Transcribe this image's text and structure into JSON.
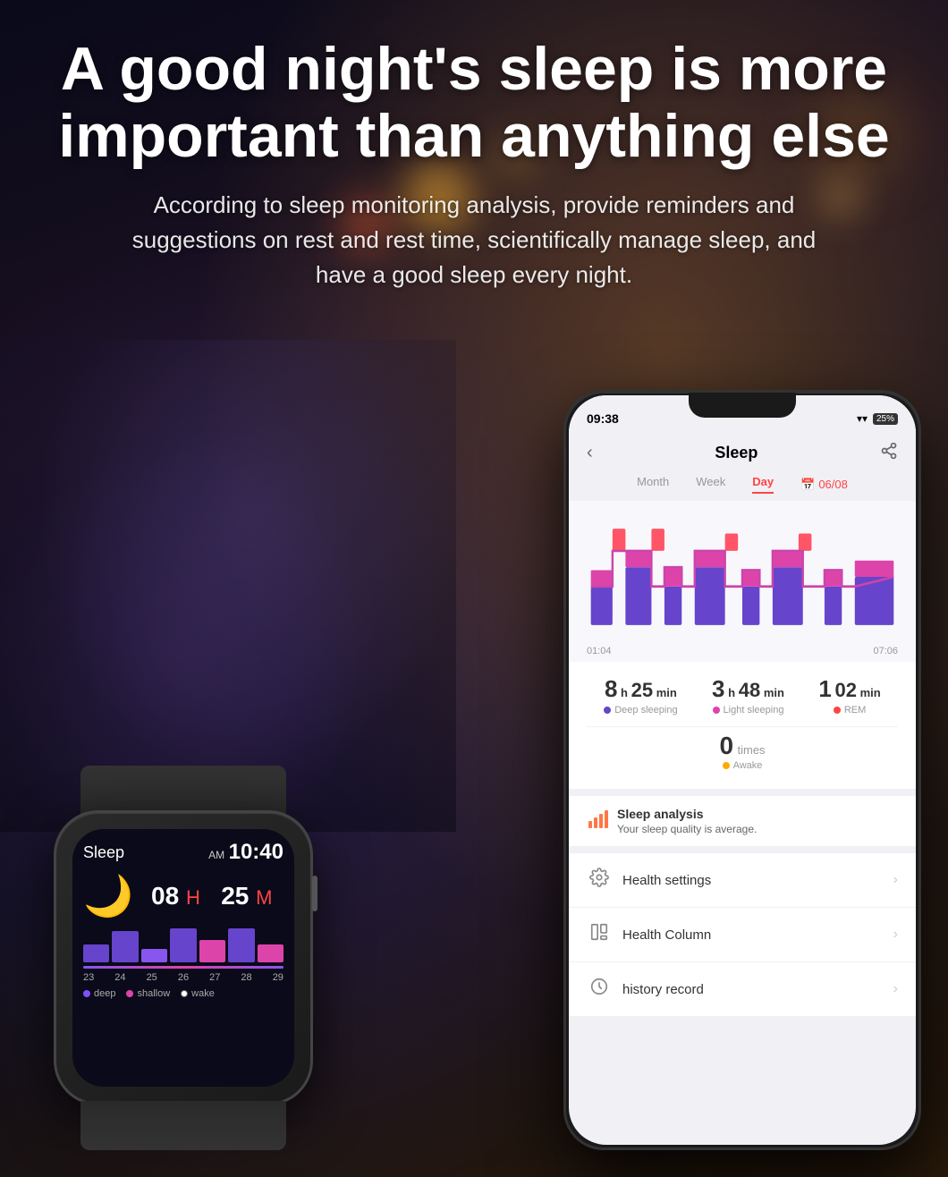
{
  "header": {
    "main_title": "A good night's sleep is more important than anything else",
    "subtitle": "According to sleep monitoring analysis, provide reminders and suggestions on rest and rest time, scientifically manage sleep, and have a good sleep every night."
  },
  "smartwatch": {
    "sleep_label": "Sleep",
    "am_pm": "AM",
    "time": "10:40",
    "hours": "08",
    "h_label": "H",
    "minutes": "25",
    "m_label": "M",
    "legend": {
      "deep": "deep",
      "shallow": "shallow",
      "wake": "wake"
    },
    "bar_numbers": [
      "23",
      "24",
      "25",
      "26",
      "27",
      "28",
      "29"
    ]
  },
  "phone": {
    "status_bar": {
      "time": "09:38",
      "wifi_icon": "wifi",
      "battery": "25%"
    },
    "nav": {
      "back_icon": "‹",
      "title": "Sleep",
      "share_icon": "share"
    },
    "tabs": {
      "month": "Month",
      "week": "Week",
      "day": "Day",
      "date": "06/08"
    },
    "chart": {
      "time_start": "01:04",
      "time_end": "07:06"
    },
    "stats": {
      "deep_hours": "8",
      "deep_h_label": "h",
      "deep_minutes": "25",
      "deep_min_label": "min",
      "deep_label": "Deep sleeping",
      "light_hours": "3",
      "light_h_label": "h",
      "light_minutes": "48",
      "light_min_label": "min",
      "light_label": "Light sleeping",
      "rem_hours": "1",
      "rem_h_label": "",
      "rem_minutes": "02",
      "rem_min_label": "min",
      "rem_label": "REM",
      "awake_count": "0",
      "awake_unit": "times",
      "awake_label": "Awake"
    },
    "analysis": {
      "title": "Sleep analysis",
      "description": "Your sleep quality is average."
    },
    "menu_items": [
      {
        "icon": "⚙",
        "label": "Health settings",
        "has_arrow": true
      },
      {
        "icon": "☰",
        "label": "Health Column",
        "has_arrow": true
      },
      {
        "icon": "⏱",
        "label": "history record",
        "has_arrow": true
      }
    ]
  },
  "colors": {
    "purple": "#8050ff",
    "pink": "#dd44aa",
    "red": "#ff4444",
    "orange": "#ff7744",
    "deep_sleep": "#6644cc",
    "light_sleep": "#dd44aa",
    "rem": "#ff4444",
    "awake": "#ffaa00"
  }
}
